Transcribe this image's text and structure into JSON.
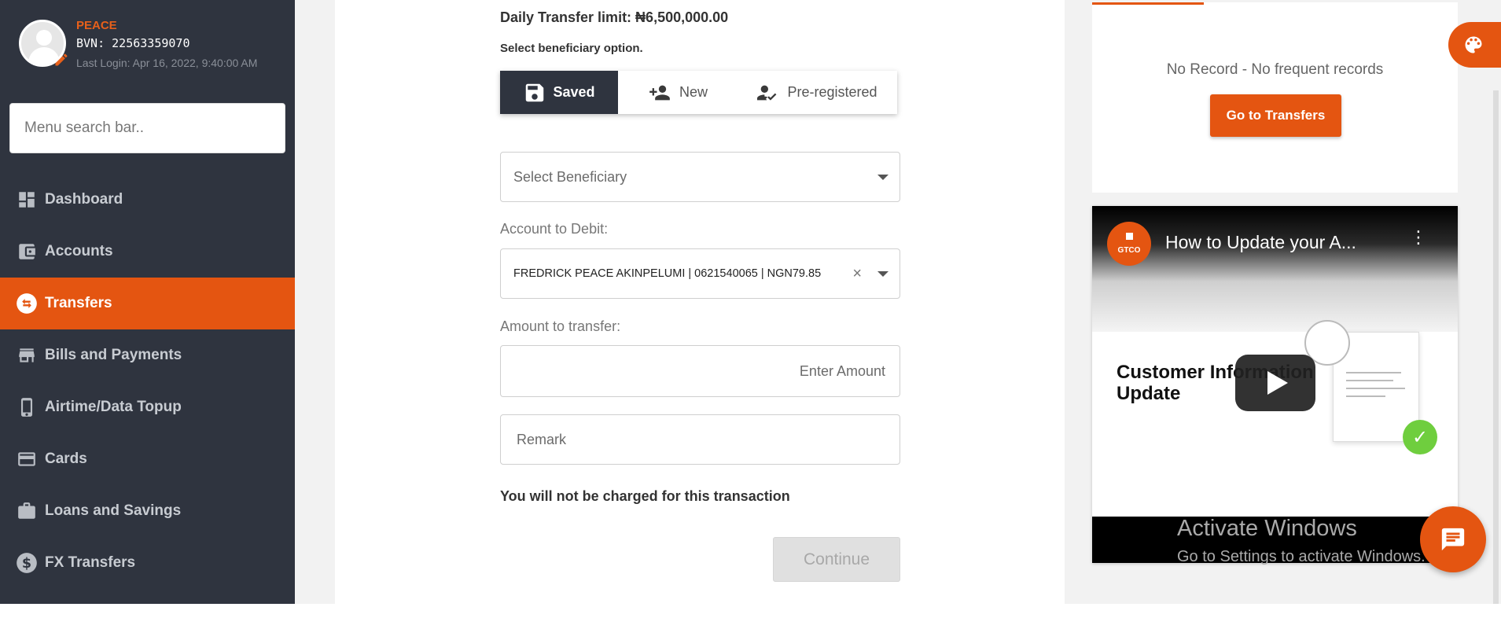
{
  "profile": {
    "name": "PEACE",
    "bvn": "BVN: 22563359070",
    "last_login": "Last Login: Apr 16, 2022, 9:40:00 AM"
  },
  "menu_search": {
    "placeholder": "Menu search bar.."
  },
  "sidebar": {
    "items": [
      {
        "label": "Dashboard",
        "icon": "dashboard-icon",
        "active": false
      },
      {
        "label": "Accounts",
        "icon": "wallet-icon",
        "active": false
      },
      {
        "label": "Transfers",
        "icon": "transfer-icon",
        "active": true
      },
      {
        "label": "Bills and Payments",
        "icon": "store-icon",
        "active": false
      },
      {
        "label": "Airtime/Data Topup",
        "icon": "phone-icon",
        "active": false
      },
      {
        "label": "Cards",
        "icon": "card-icon",
        "active": false
      },
      {
        "label": "Loans and Savings",
        "icon": "briefcase-icon",
        "active": false
      },
      {
        "label": "FX Transfers",
        "icon": "dollar-icon",
        "active": false
      }
    ]
  },
  "transfer_form": {
    "daily_limit": "Daily Transfer limit: ₦6,500,000.00",
    "select_option_label": "Select beneficiary option.",
    "beneficiary_options": [
      {
        "label": "Saved",
        "icon": "save-icon",
        "selected": true
      },
      {
        "label": "New",
        "icon": "add-person-icon",
        "selected": false
      },
      {
        "label": "Pre-registered",
        "icon": "person-check-icon",
        "selected": false
      }
    ],
    "select_beneficiary_placeholder": "Select Beneficiary",
    "account_to_debit_label": "Account to Debit:",
    "account_to_debit_value": "FREDRICK PEACE AKINPELUMI | 0621540065 | NGN79.85",
    "amount_label": "Amount to transfer:",
    "amount_placeholder": "Enter Amount",
    "remark_placeholder": "Remark",
    "charge_note": "You will not be charged for this transaction",
    "continue_label": "Continue"
  },
  "frequent": {
    "no_record": "No Record - No frequent records",
    "go_button": "Go to Transfers"
  },
  "video": {
    "channel_logo_text": "GTCO",
    "title": "How to Update your A...",
    "thumbnail_heading": "Customer Information Update"
  },
  "watermark": {
    "title": "Activate Windows",
    "subtitle": "Go to Settings to activate Windows."
  },
  "colors": {
    "accent": "#e45511",
    "sidebar_bg": "#2f343f",
    "page_bg": "#f2f2f2"
  }
}
